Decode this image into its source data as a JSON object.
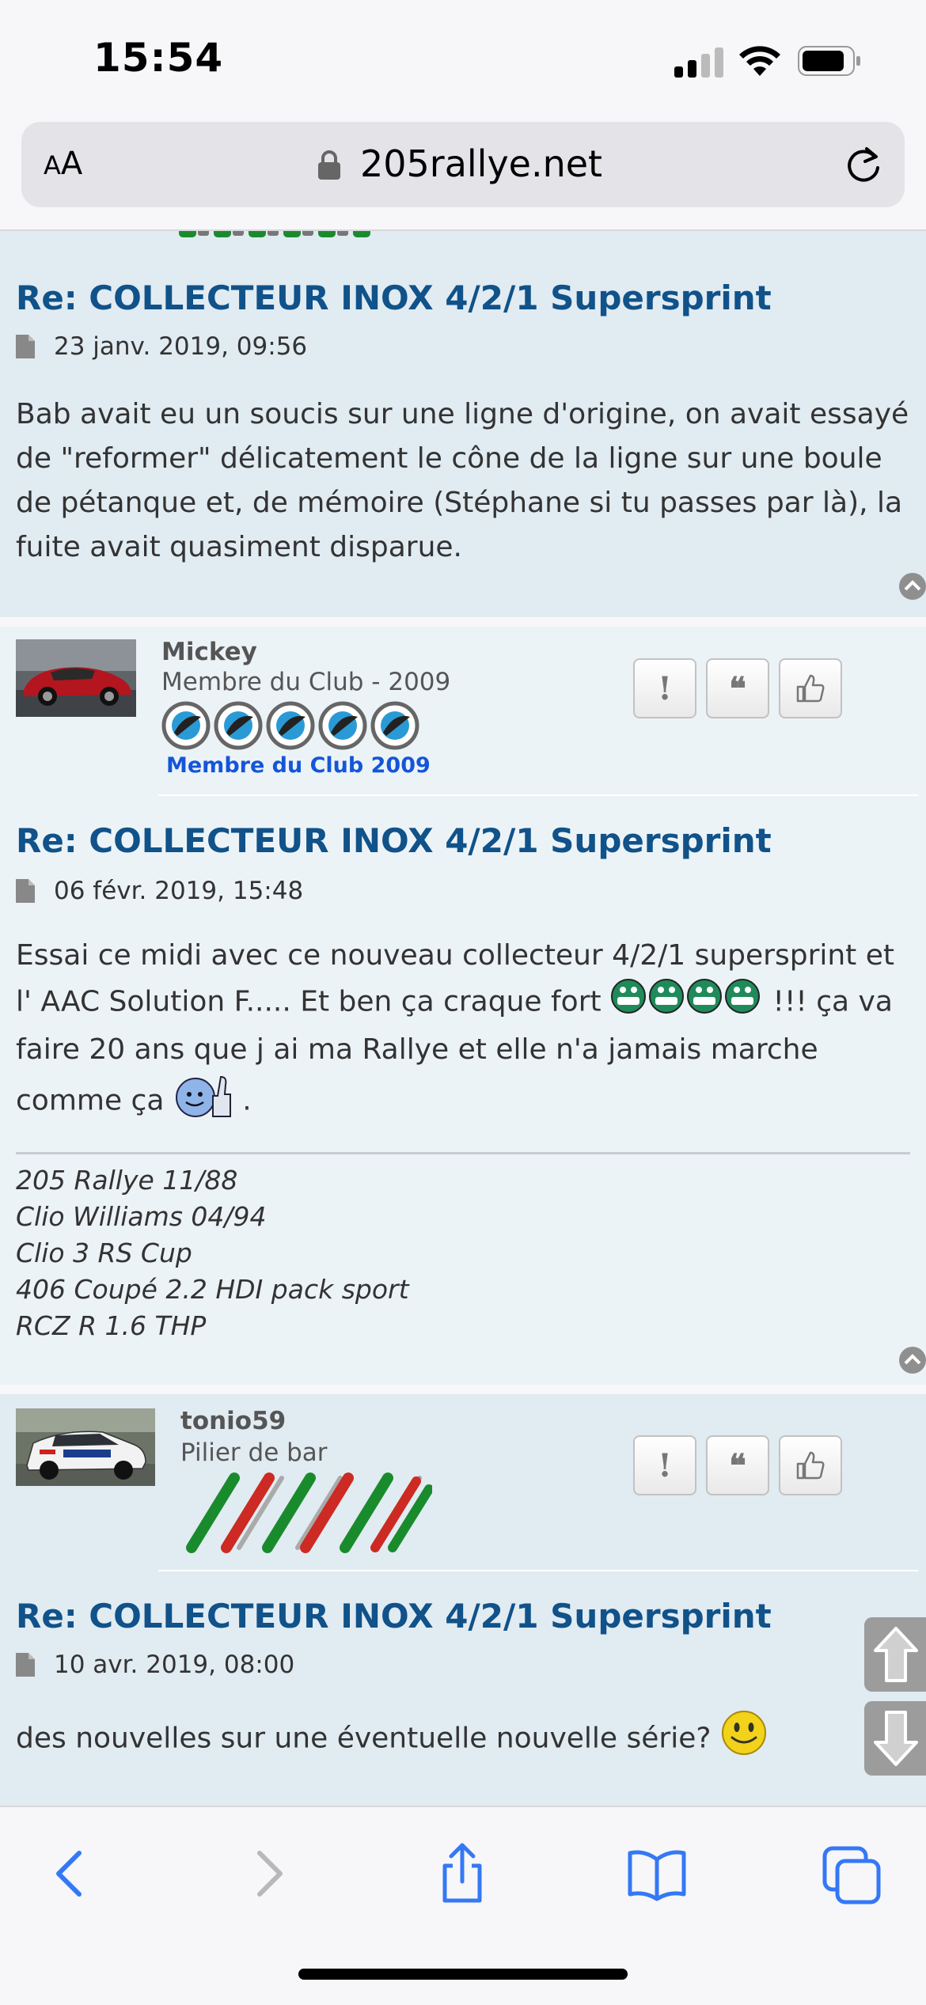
{
  "status": {
    "time": "15:54"
  },
  "browser": {
    "aa_label_small": "A",
    "aa_label_big": "A",
    "domain": "205rallye.net"
  },
  "posts": [
    {
      "title": "Re: COLLECTEUR INOX 4/2/1 Supersprint",
      "date": "23 janv. 2019, 09:56",
      "body": "Bab avait eu un soucis sur une ligne d'origine, on avait essayé de \"reformer\" délicatement le cône de la ligne sur une boule de pétanque et, de mémoire (Stéphane si tu passes par là), la fuite avait quasiment disparue."
    },
    {
      "author": "Mickey",
      "rank": "Membre du Club - 2009",
      "club_label": "Membre du Club 2009",
      "title": "Re: COLLECTEUR INOX 4/2/1 Supersprint",
      "date": "06 févr. 2019, 15:48",
      "body_part1": "Essai ce midi avec ce nouveau collecteur 4/2/1 supersprint et l' AAC Solution F..... Et ben ça craque fort ",
      "body_part2": " !!! ça va faire 20 ans que j ai ma Rallye et elle n'a jamais marche comme ça ",
      "body_part3": " .",
      "signature": [
        "205 Rallye 11/88",
        "Clio Williams 04/94",
        "Clio 3 RS Cup",
        "406 Coupé 2.2 HDI pack sport",
        "RCZ R 1.6 THP"
      ]
    },
    {
      "author": "tonio59",
      "rank": "Pilier de bar",
      "title": "Re: COLLECTEUR INOX 4/2/1 Supersprint",
      "date": "10 avr. 2019, 08:00",
      "body": "des nouvelles sur une éventuelle nouvelle série? "
    }
  ],
  "actions": {
    "report": "!",
    "quote": "❝"
  },
  "colors": {
    "link": "#105289",
    "post_bg_a": "#e1ebf2",
    "post_bg_b": "#ecf3f7",
    "ios_blue": "#3478f6"
  }
}
